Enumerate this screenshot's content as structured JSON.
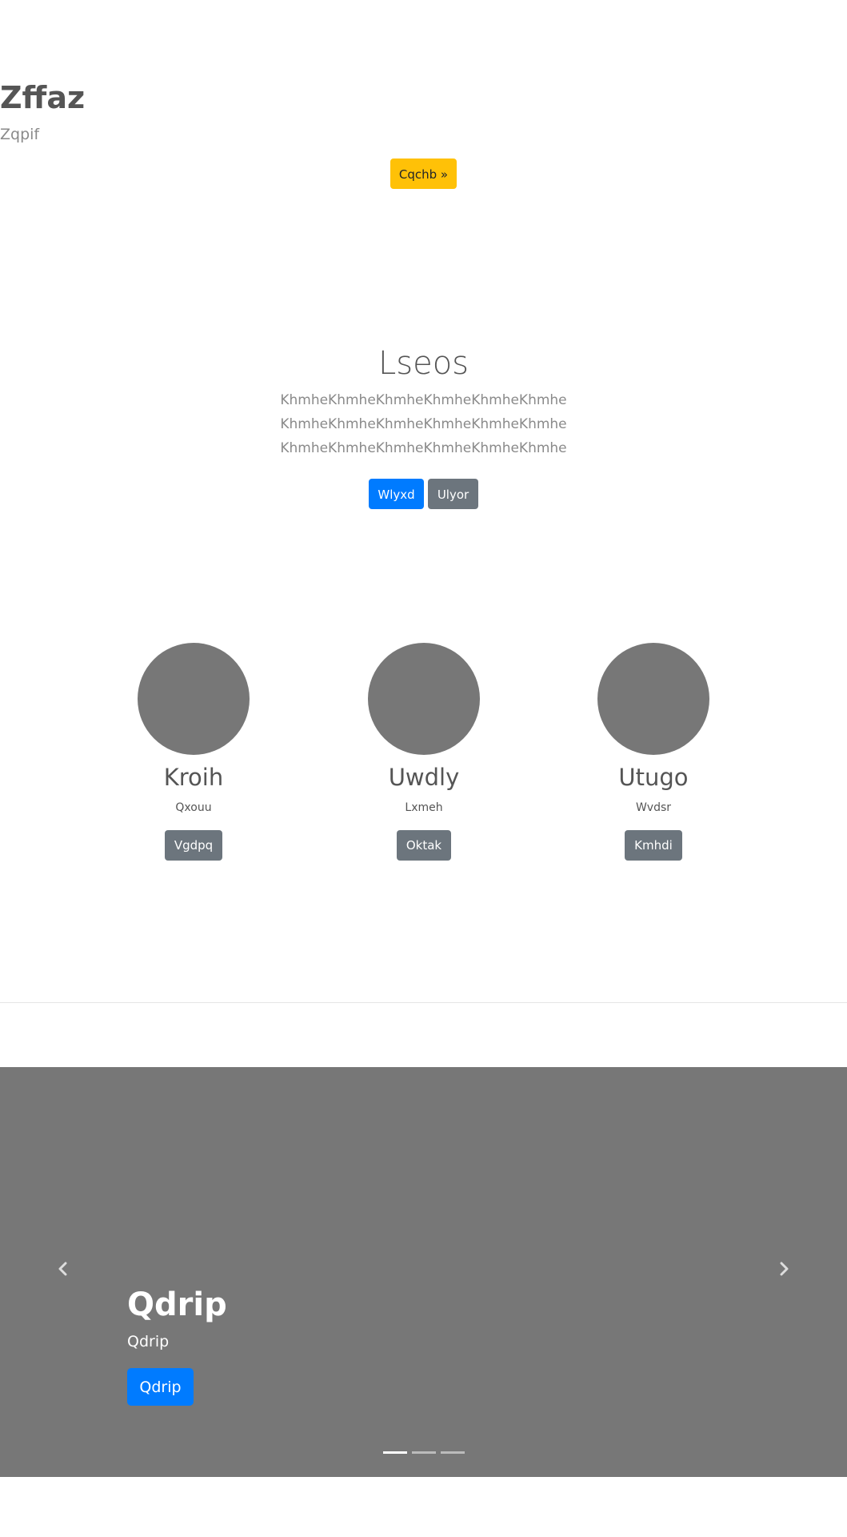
{
  "hero": {
    "title": "Zffaz",
    "subtitle": "Zqpif",
    "button_label": "Cqchb »"
  },
  "intro": {
    "title": "Lseos",
    "lead": "KhmheKhmheKhmheKhmheKhmheKhmheKhmheKhmheKhmheKhmheKhmheKhmheKhmheKhmheKhmheKhmheKhmheKhmhe",
    "primary_button": "Wlyxd",
    "secondary_button": "Ulyor"
  },
  "team": [
    {
      "name": "Kroih",
      "role": "Qxouu",
      "button": "Vgdpq"
    },
    {
      "name": "Uwdly",
      "role": "Lxmeh",
      "button": "Oktak"
    },
    {
      "name": "Utugo",
      "role": "Wvdsr",
      "button": "Kmhdi"
    }
  ],
  "carousel": {
    "slide_title": "Qdrip",
    "slide_text": "Qdrip",
    "slide_button": "Qdrip",
    "slide_count": 3,
    "active_slide": 1
  },
  "colors": {
    "warning": "#ffc107",
    "primary": "#007bff",
    "secondary": "#6c757d",
    "placeholder": "#777777"
  }
}
